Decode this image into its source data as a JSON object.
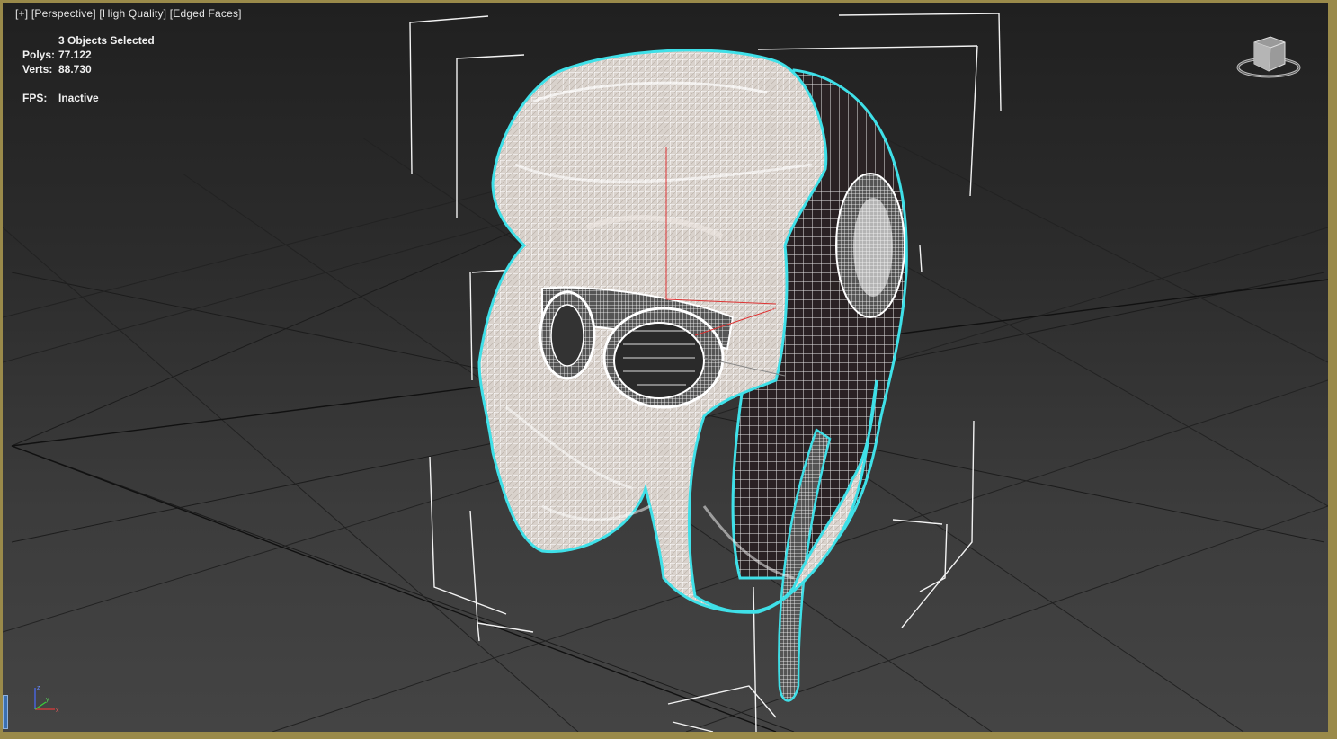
{
  "viewport": {
    "labels": {
      "menu": "[+]",
      "view": "[Perspective]",
      "shading": "[High Quality]",
      "edged": "[Edged Faces]"
    },
    "stats": {
      "selection": "3 Objects Selected",
      "polys_label": "Polys:",
      "polys_value": "77.122",
      "verts_label": "Verts:",
      "verts_value": "88.730",
      "fps_label": "FPS:",
      "fps_value": "Inactive"
    },
    "viewcube_icon": "viewcube-icon",
    "axis_icon": "axis-tripod-icon"
  },
  "colors": {
    "selection_outline": "#3fe0e8",
    "wireframe": "#ffffff",
    "grid": "#1a1a1a",
    "viewport_border": "#9a8a4a"
  }
}
